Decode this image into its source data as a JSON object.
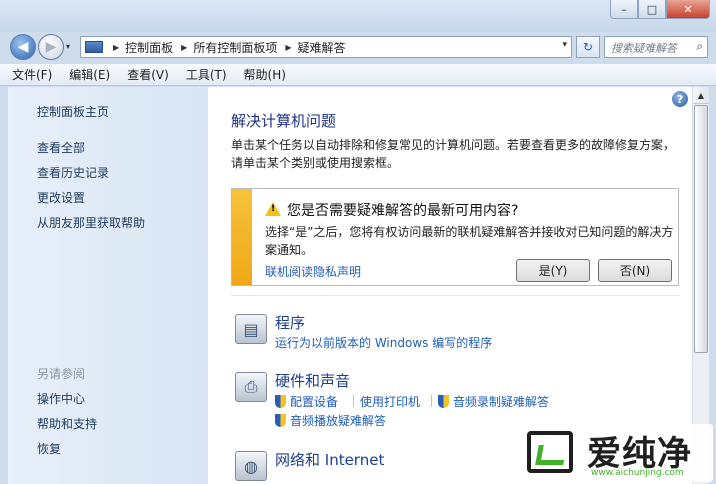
{
  "window": {
    "min_glyph": "–",
    "max_glyph": "□",
    "close_glyph": "✕"
  },
  "nav": {
    "back_glyph": "◀",
    "forward_glyph": "▶",
    "history_glyph": "▾",
    "dropdown_glyph": "▾",
    "refresh_glyph": "↻"
  },
  "address": {
    "breadcrumbs": [
      "控制面板",
      "所有控制面板项",
      "疑难解答"
    ],
    "sep_glyph": "▶"
  },
  "search": {
    "placeholder": "搜索疑难解答",
    "icon_glyph": "⌕"
  },
  "menubar": [
    "文件(F)",
    "编辑(E)",
    "查看(V)",
    "工具(T)",
    "帮助(H)"
  ],
  "sidebar": {
    "home": "控制面板主页",
    "links": [
      "查看全部",
      "查看历史记录",
      "更改设置",
      "从朋友那里获取帮助"
    ],
    "see_also": "另请参阅",
    "see_also_links": [
      "操作中心",
      "帮助和支持",
      "恢复"
    ]
  },
  "main": {
    "help_glyph": "?",
    "title": "解决计算机问题",
    "desc": "单击某个任务以自动排除和修复常见的计算机问题。若要查看更多的故障修复方案，请单击某个类别或使用搜索框。",
    "info": {
      "warn_glyph": "!",
      "question": "您是否需要疑难解答的最新可用内容?",
      "body": "选择“是”之后，您将有权访问最新的联机疑难解答并接收对已知问题的解决方案通知。",
      "privacy": "联机阅读隐私声明",
      "yes": "是(Y)",
      "no": "否(N)"
    },
    "categories": [
      {
        "name": "程序",
        "icon": "programs-icon",
        "glyph": "▤",
        "links": [
          "运行为以前版本的 Windows 编写的程序"
        ]
      },
      {
        "name": "硬件和声音",
        "icon": "printer-icon",
        "glyph": "⎙",
        "links": [
          "配置设备",
          "使用打印机",
          "音频录制疑难解答",
          "音频播放疑难解答"
        ]
      },
      {
        "name": "网络和 Internet",
        "icon": "network-icon",
        "glyph": "◍",
        "links": []
      }
    ]
  },
  "scroll": {
    "up_glyph": "▲"
  },
  "watermark": {
    "text": "爱纯净",
    "url": "www.aichunjing.com"
  }
}
